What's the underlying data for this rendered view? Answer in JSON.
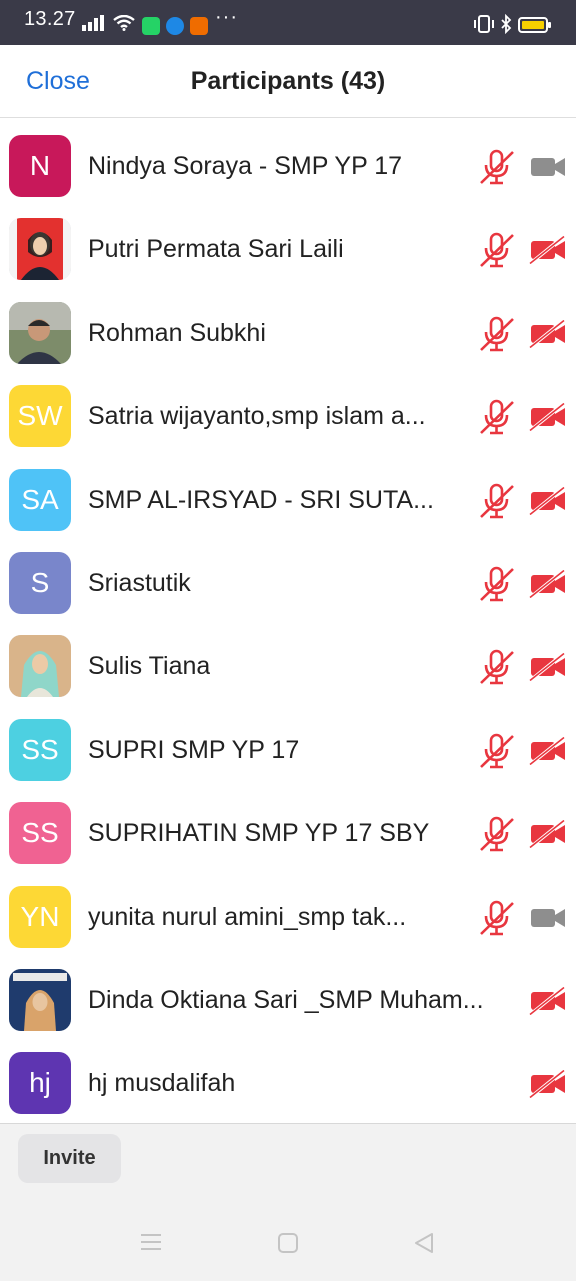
{
  "status_bar": {
    "time": "13.27",
    "more": "···",
    "icons": [
      "signal-icon",
      "wifi-icon",
      "whatsapp-icon",
      "app-icon",
      "app-icon",
      "vibrate-icon",
      "bluetooth-icon",
      "battery-icon"
    ]
  },
  "header": {
    "close_label": "Close",
    "title": "Participants (43)"
  },
  "colors": {
    "accent": "#1f6fd8",
    "muted_red": "#e8363f",
    "video_on_gray": "#8e8e8e"
  },
  "participants": [
    {
      "initials": "N",
      "name": "Nindya Soraya - SMP YP 17",
      "avatar_color": "#c8185a",
      "mic": "muted",
      "video": "on"
    },
    {
      "initials": "",
      "name": "Putri Permata Sari Laili",
      "avatar_color": "",
      "mic": "muted",
      "video": "off"
    },
    {
      "initials": "",
      "name": "Rohman Subkhi",
      "avatar_color": "",
      "mic": "muted",
      "video": "off"
    },
    {
      "initials": "SW",
      "name": "Satria wijayanto,smp islam a...",
      "avatar_color": "#fdd835",
      "mic": "muted",
      "video": "off"
    },
    {
      "initials": "SA",
      "name": "SMP AL-IRSYAD - SRI SUTA...",
      "avatar_color": "#4fc3f7",
      "mic": "muted",
      "video": "off"
    },
    {
      "initials": "S",
      "name": "Sriastutik",
      "avatar_color": "#7986cb",
      "mic": "muted",
      "video": "off"
    },
    {
      "initials": "",
      "name": "Sulis Tiana",
      "avatar_color": "",
      "mic": "muted",
      "video": "off"
    },
    {
      "initials": "SS",
      "name": "SUPRI SMP YP 17",
      "avatar_color": "#4dd0e1",
      "mic": "muted",
      "video": "off"
    },
    {
      "initials": "SS",
      "name": "SUPRIHATIN SMP YP 17 SBY",
      "avatar_color": "#f06292",
      "mic": "muted",
      "video": "off"
    },
    {
      "initials": "YN",
      "name": "yunita nurul amini_smp tak...",
      "avatar_color": "#fdd835",
      "mic": "muted",
      "video": "on"
    },
    {
      "initials": "",
      "name": "Dinda Oktiana Sari _SMP Muham...",
      "avatar_color": "",
      "mic": "none",
      "video": "off"
    },
    {
      "initials": "hj",
      "name": "hj musdalifah",
      "avatar_color": "#5e35b1",
      "mic": "none",
      "video": "off"
    }
  ],
  "footer": {
    "invite_label": "Invite"
  },
  "nav_bar": [
    "menu-icon",
    "home-icon",
    "back-icon"
  ]
}
